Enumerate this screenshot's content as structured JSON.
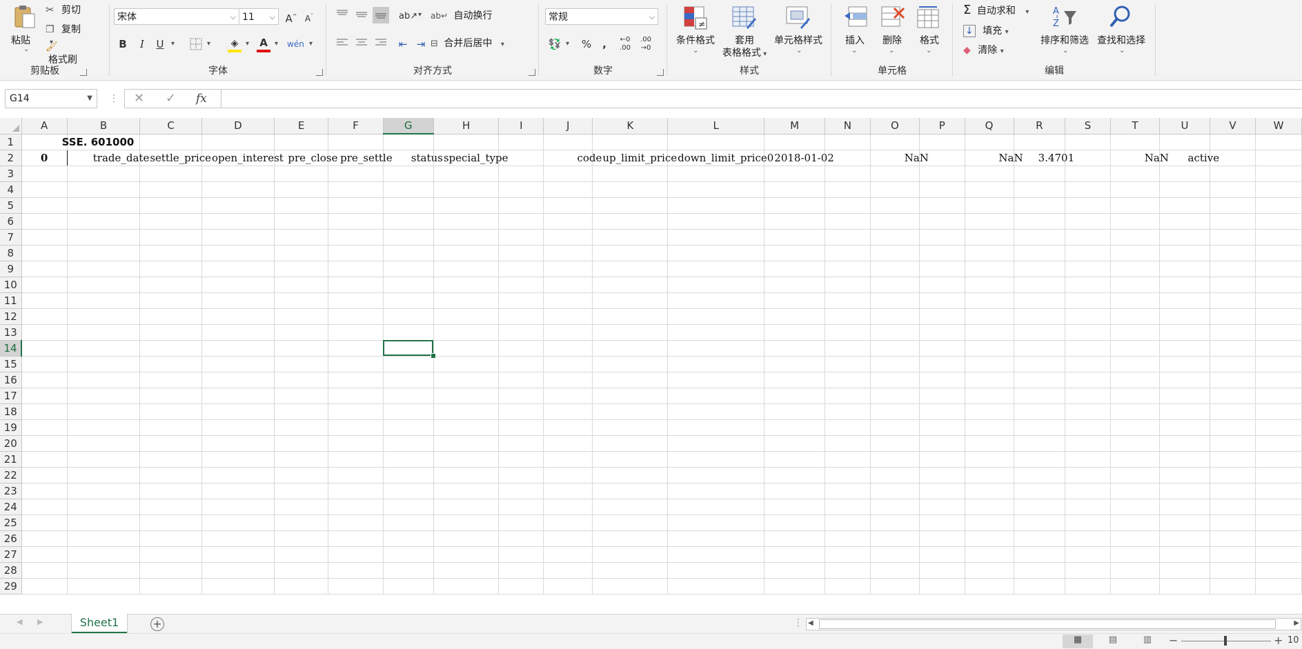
{
  "ribbon": {
    "clipboard": {
      "group": "剪贴板",
      "paste": "粘贴",
      "cut": "剪切",
      "copy": "复制",
      "format_painter": "格式刷"
    },
    "font": {
      "group": "字体",
      "name": "宋体",
      "size": "11"
    },
    "alignment": {
      "group": "对齐方式",
      "wrap": "自动换行",
      "merge": "合并后居中"
    },
    "number": {
      "group": "数字",
      "format": "常规"
    },
    "styles": {
      "group": "样式",
      "conditional": "条件格式",
      "table_1": "套用",
      "table_2": "表格格式",
      "cell_styles": "单元格样式"
    },
    "cells": {
      "group": "单元格",
      "insert": "插入",
      "delete": "删除",
      "format": "格式"
    },
    "editing": {
      "group": "编辑",
      "autosum": "自动求和",
      "fill": "填充",
      "clear": "清除",
      "sort": "排序和筛选",
      "find": "查找和选择"
    }
  },
  "formula_bar": {
    "name_box": "G14",
    "formula": ""
  },
  "grid": {
    "columns": [
      "A",
      "B",
      "C",
      "D",
      "E",
      "F",
      "G",
      "H",
      "I",
      "J",
      "K",
      "L",
      "M",
      "N",
      "O",
      "P",
      "Q",
      "R",
      "S",
      "T",
      "U",
      "V",
      "W"
    ],
    "selected_column": "G",
    "selected_row": 14,
    "row_count": 29,
    "row1": {
      "B": "SSE. 601000"
    },
    "row2": {
      "A": "0",
      "B": "trade_date",
      "C": "settle_price",
      "D": "open_interest",
      "E": "pre_close",
      "F": "pre_settle",
      "G": "status",
      "H": "special_type",
      "J": "code",
      "K": "up_limit_price",
      "L": "down_limit_price0",
      "M": "2018-01-02",
      "O": "NaN",
      "Q": "NaN",
      "R": "3.4701",
      "T": "NaN",
      "U": "active"
    }
  },
  "sheets": {
    "tabs": [
      "Sheet1"
    ],
    "active": "Sheet1"
  },
  "status": {
    "zoom": "10"
  }
}
